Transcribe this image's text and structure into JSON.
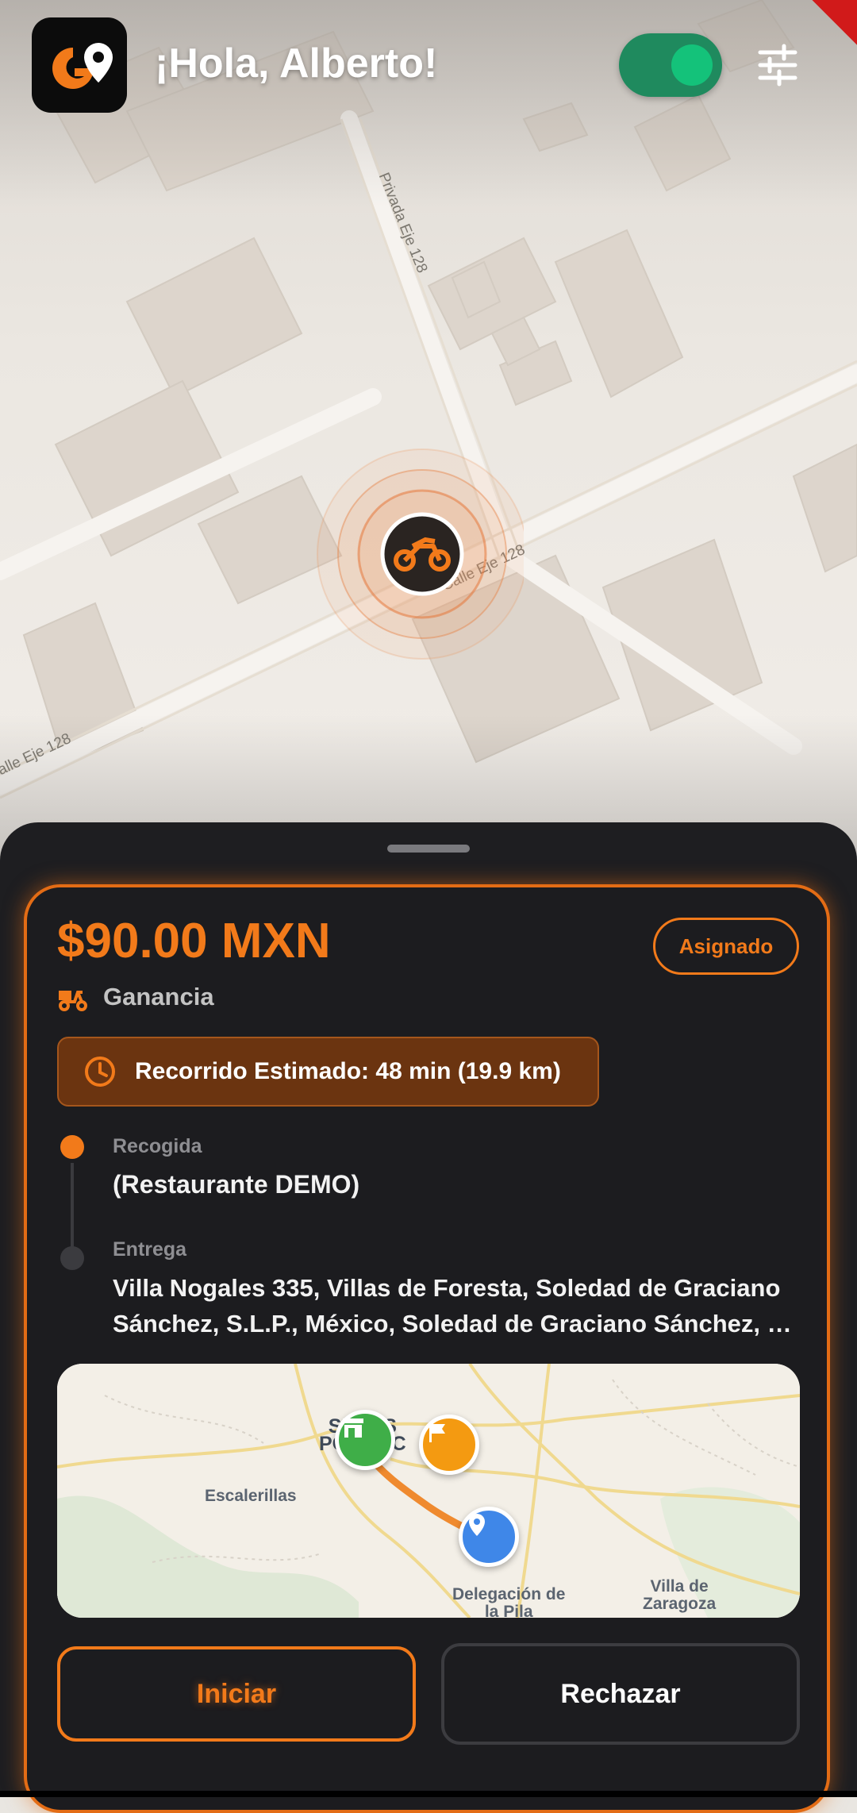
{
  "header": {
    "greeting": "¡Hola, Alberto!",
    "online_toggle": {
      "state": "on",
      "color": "#14c27a"
    },
    "filter_icon": "sliders-icon",
    "logo_icon": "go-logo-icon"
  },
  "map": {
    "streets": [
      "Privada Eje 128",
      "Calle Eje 128",
      "alle Eje 128"
    ],
    "rider_icon": "motorcycle-icon"
  },
  "order": {
    "price": "$90.00 MXN",
    "status": "Asignado",
    "earning_label": "Ganancia",
    "eta_text": "Recorrido Estimado: 48 min (19.9 km)",
    "pickup": {
      "label": "Recogida",
      "value": "(Restaurante DEMO)"
    },
    "dropoff": {
      "label": "Entrega",
      "line1": "Villa Nogales 335, Villas de Foresta, Soledad de Graciano",
      "line2": "Sánchez, S.L.P., México, Soledad de Graciano Sánchez, S..."
    },
    "mini_map": {
      "labels": {
        "escalerillas": "Escalerillas",
        "delegacion_line1": "Delegación de",
        "delegacion_line2": "la Pila",
        "villa_line1": "Villa de",
        "villa_line2": "Zaragoza",
        "city_line1": "S    UIS",
        "city_line2": "PO        C"
      },
      "pins": [
        "store-icon",
        "flag-icon",
        "location-pin-icon"
      ]
    },
    "actions": {
      "start": "Iniciar",
      "reject": "Rechazar"
    }
  },
  "colors": {
    "accent": "#f27a1a",
    "sheet": "#1e1e21",
    "eta_bg": "#6b3410",
    "online": "#14c27a"
  }
}
